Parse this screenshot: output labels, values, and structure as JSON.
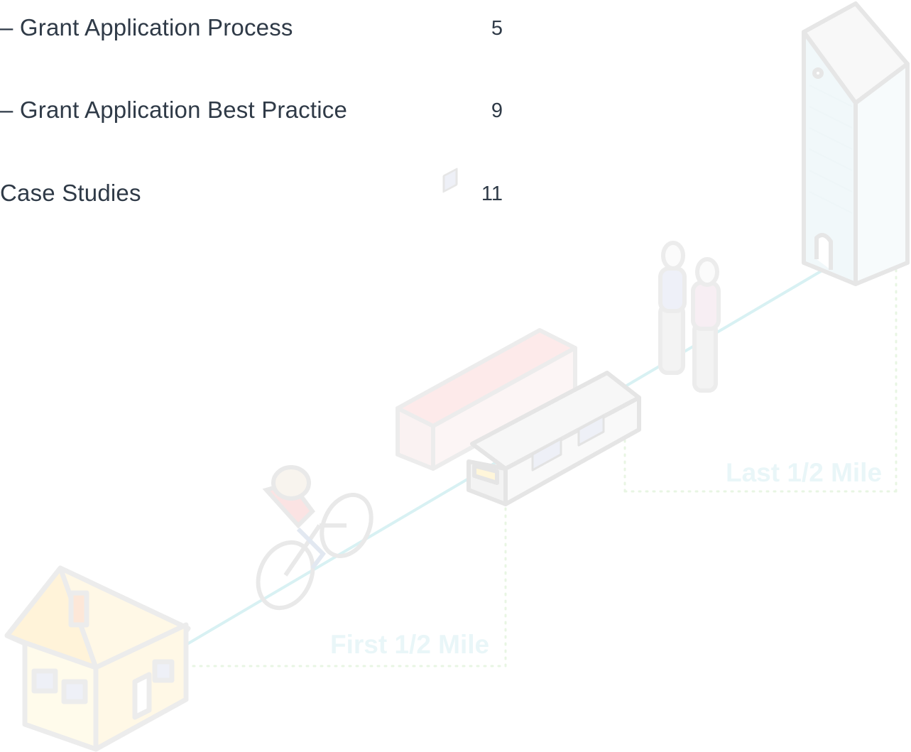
{
  "toc": {
    "entries": [
      {
        "title": "– Grant Application Process",
        "page": "5"
      },
      {
        "title": "– Grant Application Best Practice",
        "page": "9"
      },
      {
        "title": "Case Studies",
        "page": "11"
      }
    ]
  },
  "illustration": {
    "first_mile_label": "First 1/2 Mile",
    "last_mile_label": "Last 1/2 Mile"
  },
  "colors": {
    "text": "#2f3a47",
    "path_line": "#d8f1f3",
    "label": "#e9f6f8",
    "outline": "#e6e6e6"
  }
}
